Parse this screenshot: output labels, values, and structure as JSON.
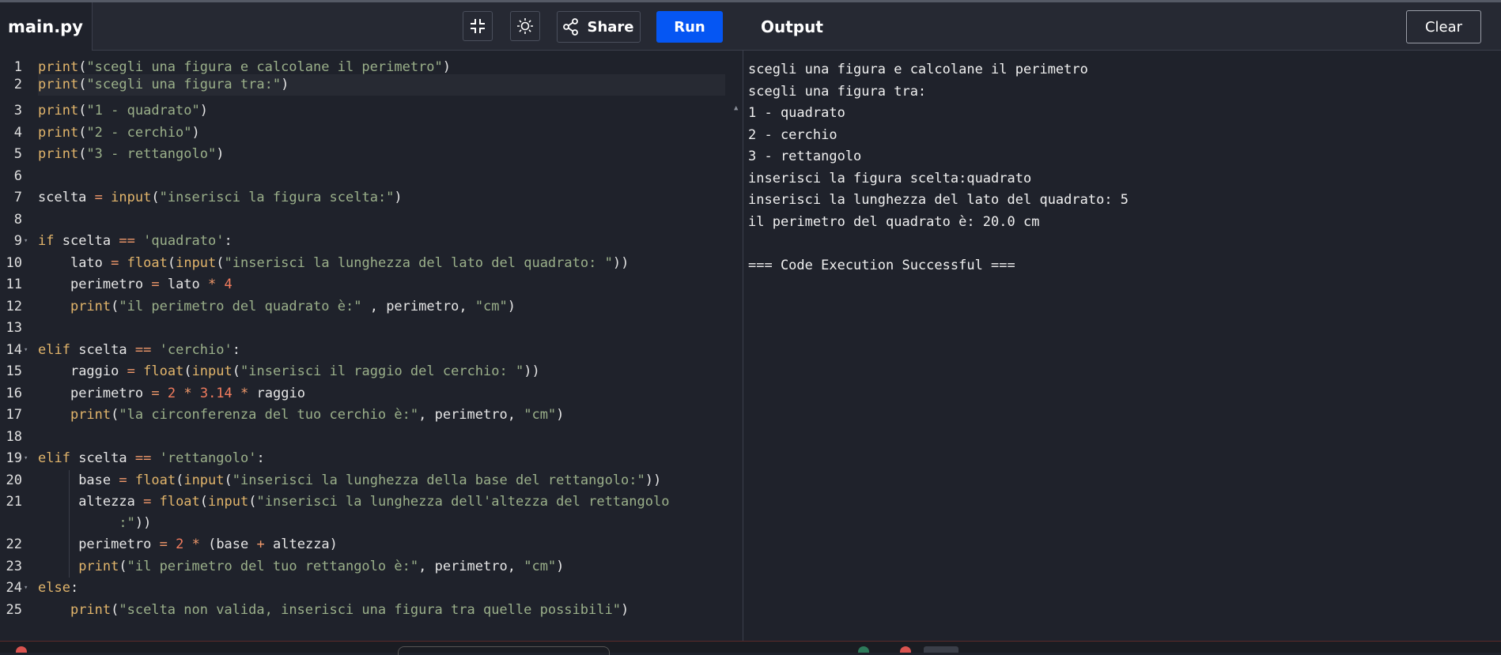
{
  "header": {
    "file_tab": "main.py",
    "share_label": "Share",
    "run_label": "Run",
    "output_title": "Output",
    "clear_label": "Clear"
  },
  "editor": {
    "line_numbers": [
      "1",
      "2",
      "3",
      "4",
      "5",
      "6",
      "7",
      "8",
      "9",
      "10",
      "11",
      "12",
      "13",
      "14",
      "15",
      "16",
      "17",
      "18",
      "19",
      "20",
      "21",
      "22",
      "23",
      "24",
      "25"
    ],
    "lines": [
      "print(\"scegli una figura e calcolane il perimetro\")",
      "print(\"scegli una figura tra:\")",
      "print(\"1 - quadrato\")",
      "print(\"2 - cerchio\")",
      "print(\"3 - rettangolo\")",
      "",
      "scelta = input(\"inserisci la figura scelta:\")",
      "",
      "if scelta == 'quadrato':",
      "    lato = float(input(\"inserisci la lunghezza del lato del quadrato: \"))",
      "    perimetro = lato * 4",
      "    print(\"il perimetro del quadrato è:\" , perimetro, \"cm\")",
      "",
      "elif scelta == 'cerchio':",
      "    raggio = float(input(\"inserisci il raggio del cerchio: \"))",
      "    perimetro = 2 * 3.14 * raggio",
      "    print(\"la circonferenza del tuo cerchio è:\", perimetro, \"cm\")",
      "",
      "elif scelta == 'rettangolo':",
      "     base = float(input(\"inserisci la lunghezza della base del rettangolo:\"))",
      "     altezza = float(input(\"inserisci la lunghezza dell'altezza del rettangolo :\"))",
      "     perimetro = 2 * (base + altezza)",
      "     print(\"il perimetro del tuo rettangolo è:\", perimetro, \"cm\")",
      "else:",
      "    print(\"scelta non valida, inserisci una figura tra quelle possibili\")"
    ]
  },
  "output": {
    "lines": [
      "scegli una figura e calcolane il perimetro",
      "scegli una figura tra:",
      "1 - quadrato",
      "2 - cerchio",
      "3 - rettangolo",
      "inserisci la figura scelta:quadrato",
      "inserisci la lunghezza del lato del quadrato: 5",
      "il perimetro del quadrato è: 20.0 cm",
      "",
      "=== Code Execution Successful ==="
    ]
  },
  "colors": {
    "background": "#1f222b",
    "run_button": "#0556f3",
    "keyword": "#e2b56b",
    "string": "#9bb08a",
    "number": "#f27c5e"
  }
}
